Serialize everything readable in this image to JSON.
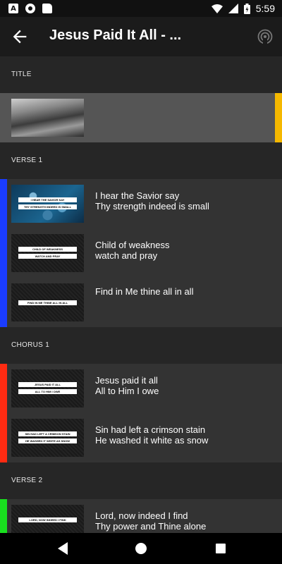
{
  "status_bar": {
    "time": "5:59",
    "icons": [
      "a-icon",
      "record-icon",
      "sd-card-icon",
      "wifi-icon",
      "signal-icon",
      "battery-icon"
    ]
  },
  "app_bar": {
    "title": "Jesus Paid It All - ...",
    "back_icon": "arrow-left-icon",
    "cast_icon": "broadcast-icon"
  },
  "colors": {
    "title_bar": "#000000",
    "title_accent": "#f5b800",
    "verse1": "#1a3cff",
    "chorus1": "#ff2b12",
    "verse2": "#19e01f"
  },
  "sections": [
    {
      "label": "TITLE"
    },
    {
      "label": "VERSE 1",
      "slides": [
        {
          "line1": "I hear the Savior say",
          "line2": "Thy strength indeed is small",
          "cap1": "I HEAR THE SAVIOR SAY",
          "cap2": "THY STRENGTH INDEED IS SMALL"
        },
        {
          "line1": "Child of weakness",
          "line2": "watch and pray",
          "cap1": "CHILD OF WEAKNESS",
          "cap2": "WATCH AND PRAY"
        },
        {
          "line1": "Find in Me thine all in all",
          "line2": "",
          "cap1": "FIND IN ME THINE ALL IN ALL"
        }
      ]
    },
    {
      "label": "CHORUS 1",
      "slides": [
        {
          "line1": "Jesus paid it all",
          "line2": "All to Him I owe",
          "cap1": "JESUS PAID IT ALL",
          "cap2": "ALL TO HIM I OWE"
        },
        {
          "line1": "Sin had left a crimson stain",
          "line2": "He washed it white as snow",
          "cap1": "SIN HAD LEFT A CRIMSON STAIN",
          "cap2": "HE WASHED IT WHITE AS SNOW"
        }
      ]
    },
    {
      "label": "VERSE 2",
      "slides": [
        {
          "line1": "Lord, now indeed I find",
          "line2": "Thy power and Thine alone",
          "cap1": "LORD, NOW INDEED I FIND"
        }
      ]
    }
  ],
  "nav": {
    "back_icon": "triangle-back-icon",
    "home_icon": "circle-home-icon",
    "recents_icon": "square-recents-icon"
  }
}
